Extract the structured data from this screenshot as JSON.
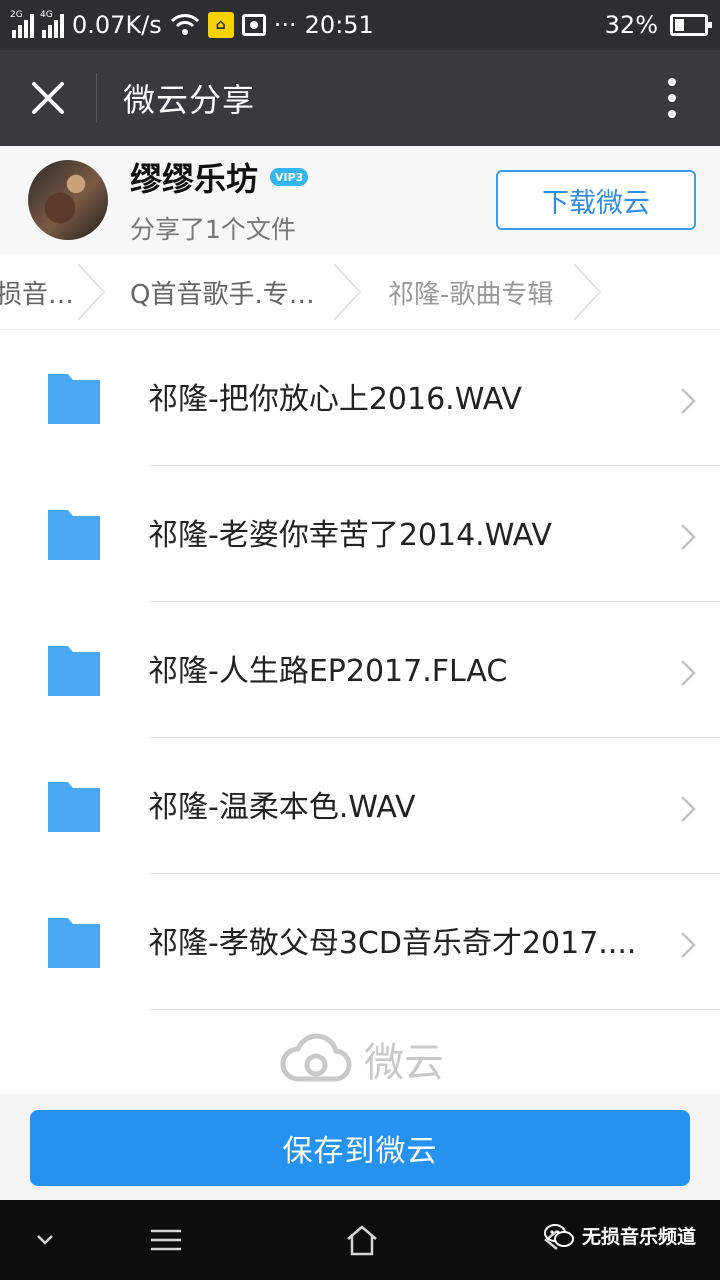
{
  "status_bar": {
    "network_1": "2G",
    "network_2": "4G",
    "speed": "0.07K/s",
    "time": "20:51",
    "dots": "···",
    "battery": "32%",
    "battery_level": 0.32,
    "badge_icon": "home-badge-icon"
  },
  "title_bar": {
    "title": "微云分享",
    "close_icon": "close-icon",
    "more_icon": "more-vertical-icon"
  },
  "sharer": {
    "name": "缪缪乐坊",
    "vip_label": "VIP3",
    "subtitle": "分享了1个文件",
    "download_button": "下载微云"
  },
  "breadcrumb": {
    "items": [
      "损音…",
      "Q首音歌手.专…",
      "祁隆-歌曲专辑"
    ]
  },
  "files": [
    {
      "name": "祁隆-把你放心上2016.WAV"
    },
    {
      "name": "祁隆-老婆你幸苦了2014.WAV"
    },
    {
      "name": "祁隆-人生路EP2017.FLAC"
    },
    {
      "name": "祁隆-温柔本色.WAV"
    },
    {
      "name": "祁隆-孝敬父母3CD音乐奇才2017...."
    }
  ],
  "watermark": "微云",
  "save_button": "保存到微云",
  "nav": {
    "wechat_label": "无损音乐频道"
  },
  "colors": {
    "accent": "#2592f0",
    "folder": "#4aa8f5",
    "titlebar": "#393a3e"
  }
}
